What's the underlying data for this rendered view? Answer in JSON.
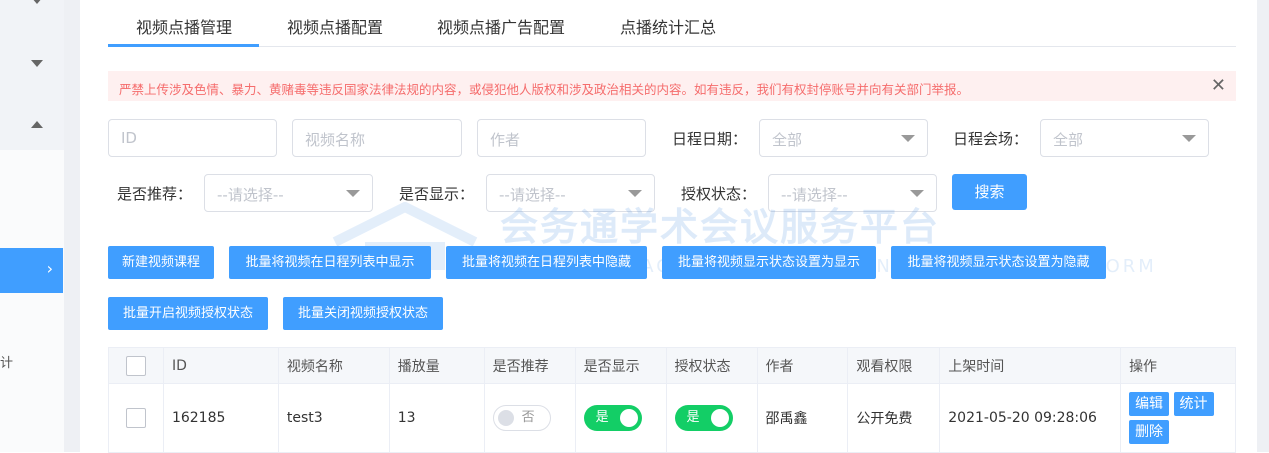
{
  "tabs": [
    {
      "label": "视频点播管理"
    },
    {
      "label": "视频点播配置"
    },
    {
      "label": "视频点播广告配置"
    },
    {
      "label": "点播统计汇总"
    }
  ],
  "alert": {
    "text": "严禁上传涉及色情、暴力、黄赌毒等违反国家法律法规的内容，或侵犯他人版权和涉及政治相关的内容。如有违反，我们有权封停账号并向有关部门举报。"
  },
  "sidebar": {
    "partial_label": "计"
  },
  "filters": {
    "id_placeholder": "ID",
    "name_placeholder": "视频名称",
    "author_placeholder": "作者",
    "date_label": "日程日期：",
    "date_value": "全部",
    "venue_label": "日程会场：",
    "venue_value": "全部",
    "recommend_label": "是否推荐：",
    "recommend_value": "--请选择--",
    "display_label": "是否显示：",
    "display_value": "--请选择--",
    "auth_label": "授权状态：",
    "auth_value": "--请选择--",
    "search_label": "搜索"
  },
  "watermark": {
    "title": "会务通学术会议服务平台",
    "subtitle": "HUIWUTONG ACADEMIC CONFERENCE SERVICE PLATFORM"
  },
  "actions": [
    "新建视频课程",
    "批量将视频在日程列表中显示",
    "批量将视频在日程列表中隐藏",
    "批量将视频显示状态设置为显示",
    "批量将视频显示状态设置为隐藏",
    "批量开启视频授权状态",
    "批量关闭视频授权状态"
  ],
  "table": {
    "headers": [
      "ID",
      "视频名称",
      "播放量",
      "是否推荐",
      "是否显示",
      "授权状态",
      "作者",
      "观看权限",
      "上架时间",
      "操作"
    ],
    "rows": [
      {
        "id": "162185",
        "name": "test3",
        "plays": "13",
        "recommend": "否",
        "display": "是",
        "auth": "是",
        "author": "邵禹鑫",
        "permission": "公开免费",
        "time": "2021-05-20 09:28:06",
        "ops": [
          "编辑",
          "统计",
          "删除"
        ]
      }
    ]
  },
  "colors": {
    "primary": "#409eff",
    "switch_on": "#13ce66",
    "alert_text": "#f56c6c",
    "alert_bg": "#fef0f0"
  }
}
